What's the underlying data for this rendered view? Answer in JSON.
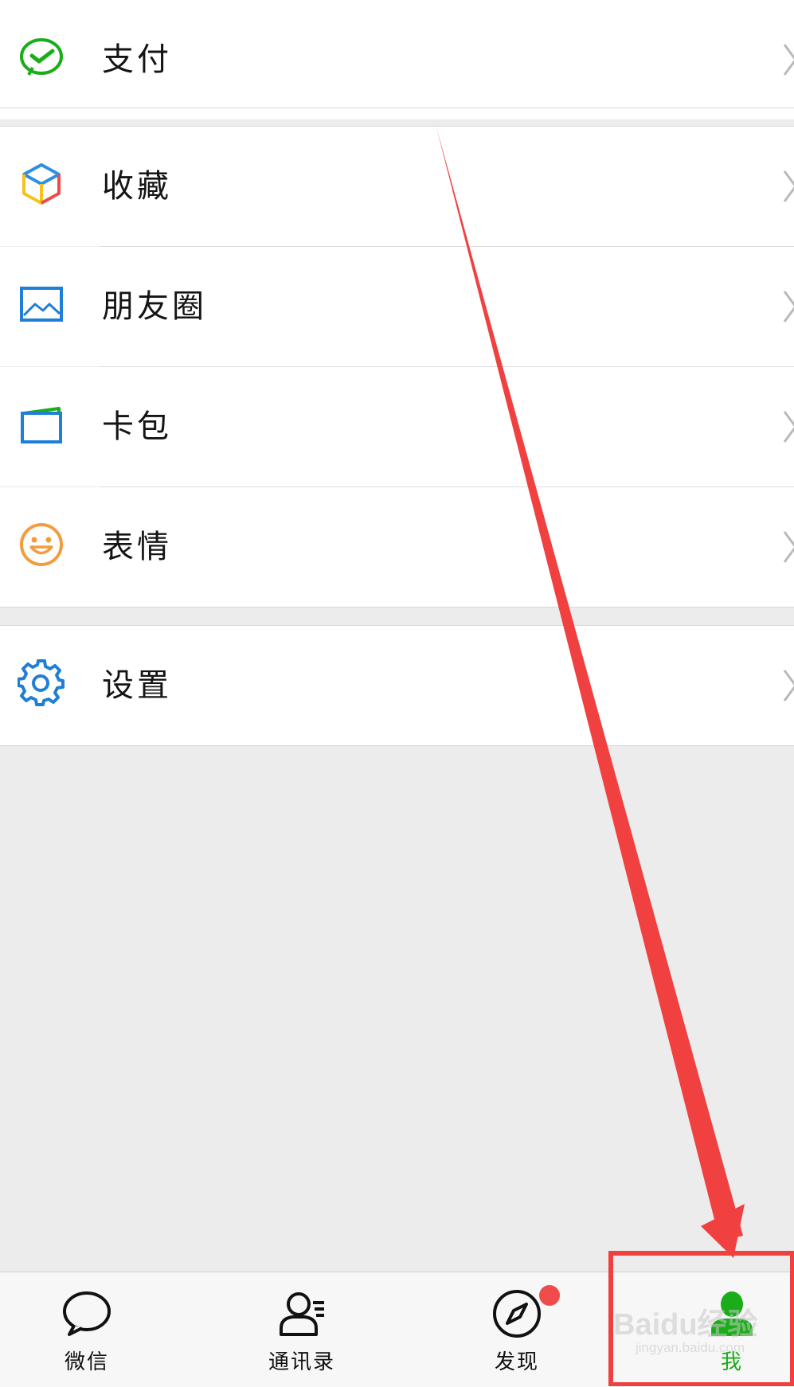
{
  "menu": {
    "pay": {
      "label": "支付",
      "icon": "pay-icon"
    },
    "favorites": {
      "label": "收藏",
      "icon": "cube-icon"
    },
    "moments": {
      "label": "朋友圈",
      "icon": "picture-icon"
    },
    "cards": {
      "label": "卡包",
      "icon": "wallet-icon"
    },
    "stickers": {
      "label": "表情",
      "icon": "smiley-icon"
    },
    "settings": {
      "label": "设置",
      "icon": "gear-icon"
    }
  },
  "tabbar": {
    "tabs": [
      {
        "label": "微信",
        "icon": "chat-bubble-icon"
      },
      {
        "label": "通讯录",
        "icon": "contacts-icon"
      },
      {
        "label": "发现",
        "icon": "compass-icon"
      },
      {
        "label": "我",
        "icon": "person-icon"
      }
    ],
    "active_index": 3
  },
  "watermark": {
    "text": "Baidu经验",
    "sub": "jingyan.baidu.com"
  },
  "colors": {
    "accent_green": "#1aad19",
    "annotation_red": "#f04040",
    "background": "#ececec",
    "icon_blue": "#1f7fd6",
    "icon_orange": "#f39c3d"
  }
}
